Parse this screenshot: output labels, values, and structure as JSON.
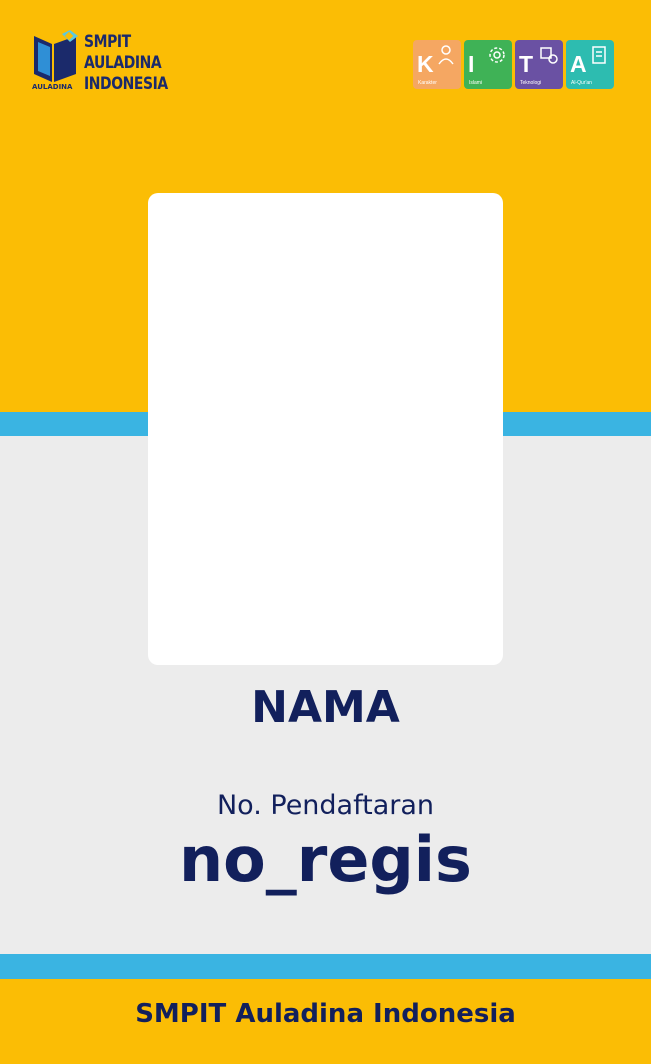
{
  "header": {
    "logo": {
      "line1": "SMPIT",
      "line2": "AULADINA",
      "line3": "INDONESIA",
      "mark_caption": "AULADINA"
    },
    "kita": [
      {
        "letter": "K",
        "caption": "Karakter",
        "color": "#f5a762",
        "icon": "person-icon"
      },
      {
        "letter": "I",
        "caption": "Islami",
        "color": "#3fb256",
        "icon": "gear-icon"
      },
      {
        "letter": "T",
        "caption": "Teknologi",
        "color": "#6a51a3",
        "icon": "chip-icon"
      },
      {
        "letter": "A",
        "caption": "Al-Qur'an",
        "color": "#2dbcb0",
        "icon": "book-icon"
      }
    ]
  },
  "card": {
    "name": "NAMA",
    "registration_label": "No. Pendaftaran",
    "registration_value": "no_regis"
  },
  "footer": {
    "school_name": "SMPIT Auladina Indonesia"
  },
  "colors": {
    "primary_yellow": "#fbbd05",
    "stripe_blue": "#3ab4e2",
    "navy_text": "#12205c",
    "background_gray": "#ececec"
  }
}
